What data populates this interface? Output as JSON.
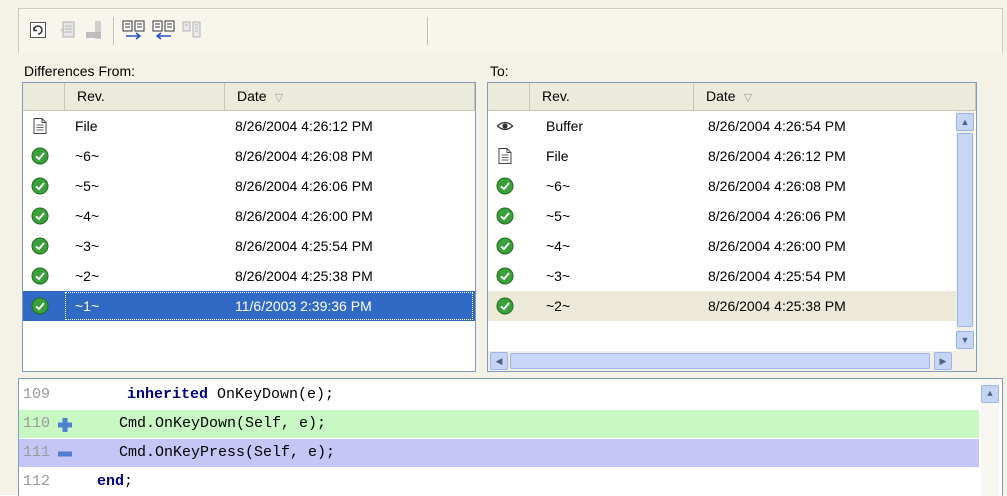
{
  "colors": {
    "accent": "#316ac5",
    "added_line": "#c8f7c4",
    "removed_line": "#c6c6f6",
    "checkin_green": "#3aa13a"
  },
  "toolbar": {
    "buttons": [
      {
        "name": "refresh-icon",
        "enabled": true
      },
      {
        "name": "revert-icon",
        "enabled": false
      },
      {
        "name": "checkin-icon",
        "enabled": false
      },
      {
        "name": "next-difference-icon",
        "enabled": true
      },
      {
        "name": "previous-difference-icon",
        "enabled": true
      },
      {
        "name": "merge-icon",
        "enabled": false
      }
    ]
  },
  "left_pane": {
    "title": "Differences From:",
    "columns": {
      "rev": "Rev.",
      "date": "Date"
    },
    "rows": [
      {
        "icon": "file-icon",
        "rev": "File",
        "date": "8/26/2004 4:26:12 PM"
      },
      {
        "icon": "revision-icon",
        "rev": "~6~",
        "date": "8/26/2004 4:26:08 PM"
      },
      {
        "icon": "revision-icon",
        "rev": "~5~",
        "date": "8/26/2004 4:26:06 PM"
      },
      {
        "icon": "revision-icon",
        "rev": "~4~",
        "date": "8/26/2004 4:26:00 PM"
      },
      {
        "icon": "revision-icon",
        "rev": "~3~",
        "date": "8/26/2004 4:25:54 PM"
      },
      {
        "icon": "revision-icon",
        "rev": "~2~",
        "date": "8/26/2004 4:25:38 PM"
      },
      {
        "icon": "revision-icon",
        "rev": "~1~",
        "date": "11/6/2003 2:39:36 PM",
        "selected": true
      }
    ]
  },
  "right_pane": {
    "title": "To:",
    "columns": {
      "rev": "Rev.",
      "date": "Date"
    },
    "rows": [
      {
        "icon": "buffer-eye-icon",
        "rev": "Buffer",
        "date": "8/26/2004 4:26:54 PM"
      },
      {
        "icon": "file-icon",
        "rev": "File",
        "date": "8/26/2004 4:26:12 PM"
      },
      {
        "icon": "revision-icon",
        "rev": "~6~",
        "date": "8/26/2004 4:26:08 PM"
      },
      {
        "icon": "revision-icon",
        "rev": "~5~",
        "date": "8/26/2004 4:26:06 PM"
      },
      {
        "icon": "revision-icon",
        "rev": "~4~",
        "date": "8/26/2004 4:26:00 PM"
      },
      {
        "icon": "revision-icon",
        "rev": "~3~",
        "date": "8/26/2004 4:25:54 PM"
      },
      {
        "icon": "revision-icon",
        "rev": "~2~",
        "date": "8/26/2004 4:25:38 PM",
        "highlighted": true
      }
    ]
  },
  "code": {
    "lines": [
      {
        "num": "109",
        "kw": "inherited",
        "text": " OnKeyDown(e);",
        "indent": "  ",
        "kind": "normal"
      },
      {
        "num": "110",
        "kw": "",
        "text": "Cmd.OnKeyDown(Self, e);",
        "indent": " ",
        "kind": "added"
      },
      {
        "num": "111",
        "kw": "",
        "text": "Cmd.OnKeyPress(Self, e);",
        "indent": " ",
        "kind": "removed"
      },
      {
        "num": "112",
        "kw": "end",
        "text": ";",
        "indent": "",
        "kind": "normal"
      }
    ]
  }
}
